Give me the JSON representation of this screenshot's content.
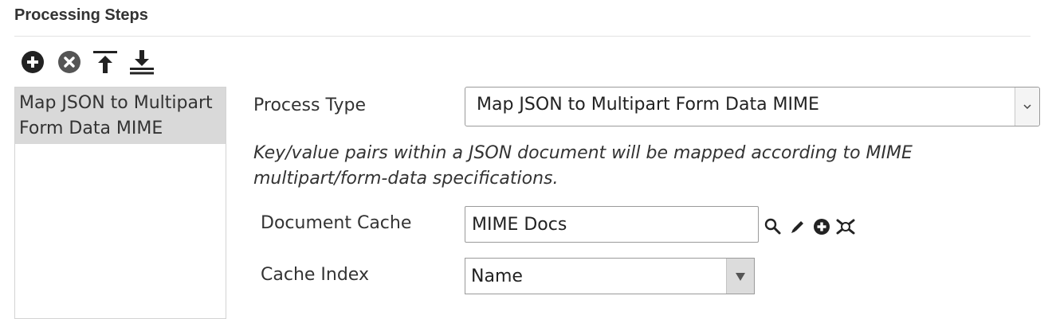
{
  "section": {
    "title": "Processing Steps"
  },
  "toolbar": {
    "buttons": [
      {
        "icon": "plus-circle-icon",
        "action": "add-step"
      },
      {
        "icon": "x-circle-icon",
        "action": "remove-step"
      },
      {
        "icon": "move-to-top-icon",
        "action": "move-top"
      },
      {
        "icon": "move-to-bottom-icon",
        "action": "move-bottom"
      }
    ]
  },
  "steps": {
    "items": [
      {
        "label": "Map JSON to Multipart Form Data MIME",
        "selected": true
      }
    ]
  },
  "form": {
    "process_type": {
      "label": "Process Type",
      "value": "Map JSON to Multipart Form Data MIME"
    },
    "description": "Key/value pairs within a JSON document will be mapped according to MIME multipart/form-data specifications.",
    "document_cache": {
      "label": "Document Cache",
      "value": "MIME Docs",
      "icons": [
        "search-icon",
        "edit-pencil-icon",
        "add-circle-icon",
        "clear-icon"
      ]
    },
    "cache_index": {
      "label": "Cache Index",
      "value": "Name"
    }
  },
  "colors": {
    "selected_item_bg": "#d9d9d9",
    "icon_dark": "#222222",
    "icon_gray": "#555555"
  }
}
